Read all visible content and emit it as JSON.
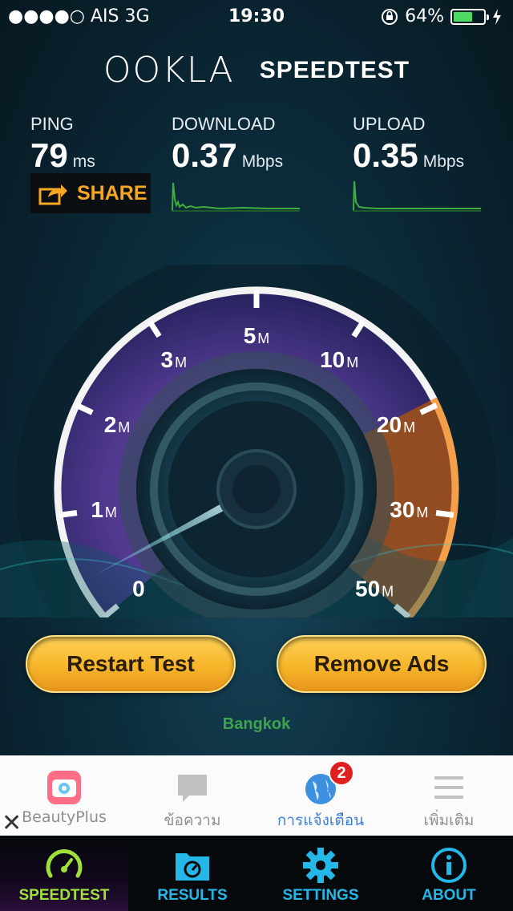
{
  "status_bar": {
    "carrier": "●●●●○ AIS   3G",
    "time": "19:30",
    "battery": "64%",
    "battery_level": 0.64
  },
  "header": {
    "logo": "OOKLA",
    "title": "SPEEDTEST"
  },
  "metrics": {
    "ping": {
      "label": "PING",
      "value": "79",
      "unit": "ms"
    },
    "download": {
      "label": "DOWNLOAD",
      "value": "0.37",
      "unit": "Mbps"
    },
    "upload": {
      "label": "UPLOAD",
      "value": "0.35",
      "unit": "Mbps"
    }
  },
  "share_label": "SHARE",
  "gauge": {
    "ticks": [
      {
        "num": "0",
        "unit": ""
      },
      {
        "num": "1",
        "unit": "M"
      },
      {
        "num": "2",
        "unit": "M"
      },
      {
        "num": "3",
        "unit": "M"
      },
      {
        "num": "5",
        "unit": "M"
      },
      {
        "num": "10",
        "unit": "M"
      },
      {
        "num": "20",
        "unit": "M"
      },
      {
        "num": "30",
        "unit": "M"
      },
      {
        "num": "50",
        "unit": "M"
      }
    ],
    "needle_value": 0.37
  },
  "buttons": {
    "restart": "Restart Test",
    "remove_ads": "Remove Ads"
  },
  "location": "Bangkok",
  "ad_bar": {
    "items": [
      {
        "label": "BeautyPlus",
        "icon": "camera-app-icon"
      },
      {
        "label": "ข้อความ",
        "icon": "chat-bubble-icon"
      },
      {
        "label": "การแจ้งเตือน",
        "icon": "globe-icon",
        "badge": "2"
      },
      {
        "label": "เพิ่มเติม",
        "icon": "menu-icon"
      }
    ],
    "close": "✕"
  },
  "tabs": [
    {
      "label": "SPEEDTEST",
      "icon": "gauge-icon",
      "active": true
    },
    {
      "label": "RESULTS",
      "icon": "folder-icon",
      "active": false
    },
    {
      "label": "SETTINGS",
      "icon": "gear-icon",
      "active": false
    },
    {
      "label": "ABOUT",
      "icon": "info-icon",
      "active": false
    }
  ],
  "colors": {
    "accent_orange": "#f7a823",
    "tab_blue": "#24b7e8",
    "active_green": "#9fe13a",
    "location_green": "#3fa34d"
  }
}
